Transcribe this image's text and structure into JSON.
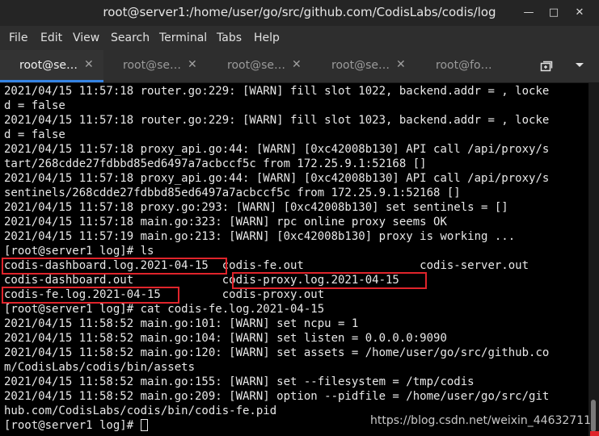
{
  "window": {
    "title": "root@server1:/home/user/go/src/github.com/CodisLabs/codis/log"
  },
  "menu": [
    "File",
    "Edit",
    "View",
    "Search",
    "Terminal",
    "Tabs",
    "Help"
  ],
  "tabs": [
    {
      "label": "root@se…",
      "active": true
    },
    {
      "label": "root@se…",
      "active": false
    },
    {
      "label": "root@se…",
      "active": false
    },
    {
      "label": "root@se…",
      "active": false
    },
    {
      "label": "root@fo…",
      "active": false
    }
  ],
  "terminal": {
    "lines": [
      "2021/04/15 11:57:18 router.go:229: [WARN] fill slot 1022, backend.addr = , locke",
      "d = false",
      "2021/04/15 11:57:18 router.go:229: [WARN] fill slot 1023, backend.addr = , locke",
      "d = false",
      "2021/04/15 11:57:18 proxy_api.go:44: [WARN] [0xc42008b130] API call /api/proxy/s",
      "tart/268cdde27fdbbd85ed6497a7acbccf5c from 172.25.9.1:52168 []",
      "2021/04/15 11:57:18 proxy_api.go:44: [WARN] [0xc42008b130] API call /api/proxy/s",
      "sentinels/268cdde27fdbbd85ed6497a7acbccf5c from 172.25.9.1:52168 []",
      "2021/04/15 11:57:18 proxy.go:293: [WARN] [0xc42008b130] set sentinels = []",
      "2021/04/15 11:57:18 main.go:323: [WARN] rpc online proxy seems OK",
      "2021/04/15 11:57:19 main.go:213: [WARN] [0xc42008b130] proxy is working ...",
      "[root@server1 log]# ls",
      "codis-dashboard.log.2021-04-15  codis-fe.out                 codis-server.out",
      "codis-dashboard.out             codis-proxy.log.2021-04-15",
      "codis-fe.log.2021-04-15         codis-proxy.out",
      "[root@server1 log]# cat codis-fe.log.2021-04-15",
      "2021/04/15 11:58:52 main.go:101: [WARN] set ncpu = 1",
      "2021/04/15 11:58:52 main.go:104: [WARN] set listen = 0.0.0.0:9090",
      "2021/04/15 11:58:52 main.go:120: [WARN] set assets = /home/user/go/src/github.co",
      "m/CodisLabs/codis/bin/assets",
      "2021/04/15 11:58:52 main.go:155: [WARN] set --filesystem = /tmp/codis",
      "2021/04/15 11:58:52 main.go:209: [WARN] option --pidfile = /home/user/go/src/git",
      "hub.com/CodisLabs/codis/bin/codis-fe.pid",
      "[root@server1 log]# "
    ]
  },
  "watermark": "https://blog.csdn.net/weixin_44632711"
}
